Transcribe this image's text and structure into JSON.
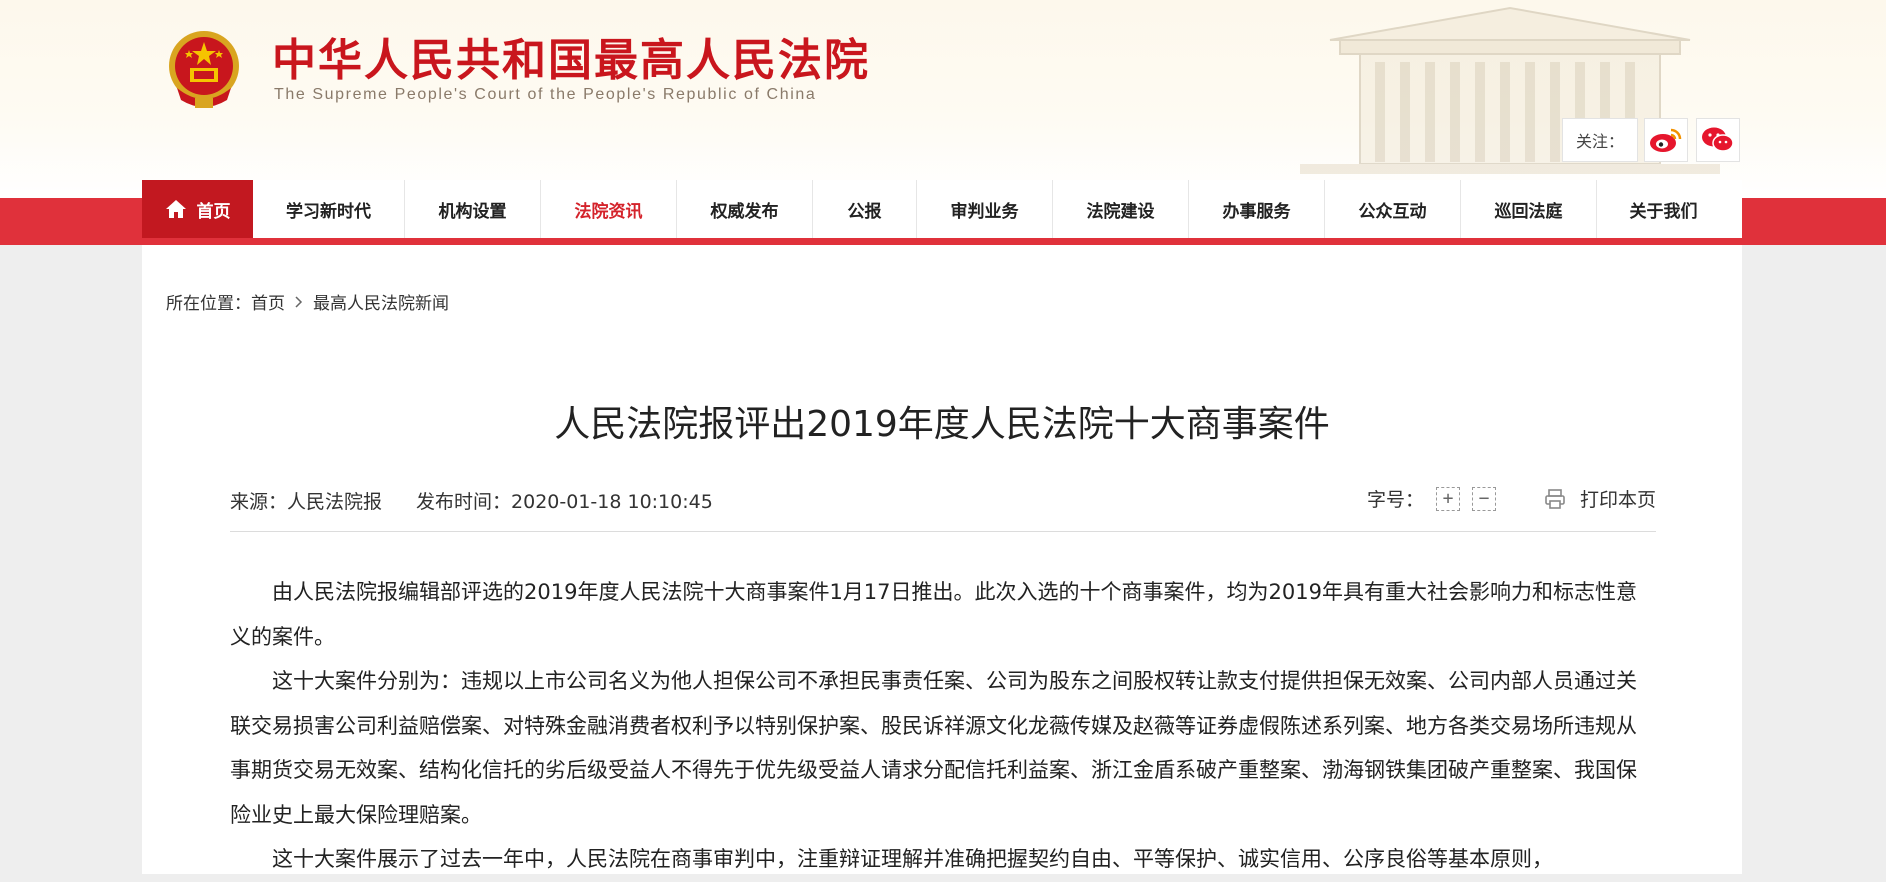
{
  "header": {
    "title": "中华人民共和国最高人民法院",
    "subtitle": "The Supreme People's Court of the People's Republic of China",
    "follow_label": "关注：",
    "social": [
      {
        "name": "weibo",
        "icon": "weibo-icon"
      },
      {
        "name": "wechat",
        "icon": "wechat-icon"
      }
    ]
  },
  "nav": {
    "items": [
      {
        "label": "首页",
        "icon": "home-icon",
        "state": "home"
      },
      {
        "label": "学习新时代"
      },
      {
        "label": "机构设置"
      },
      {
        "label": "法院资讯",
        "state": "active"
      },
      {
        "label": "权威发布"
      },
      {
        "label": "公报"
      },
      {
        "label": "审判业务"
      },
      {
        "label": "法院建设"
      },
      {
        "label": "办事服务"
      },
      {
        "label": "公众互动"
      },
      {
        "label": "巡回法庭"
      },
      {
        "label": "关于我们"
      }
    ]
  },
  "breadcrumb": {
    "label": "所在位置：",
    "items": [
      "首页",
      "最高人民法院新闻"
    ]
  },
  "article": {
    "title": "人民法院报评出2019年度人民法院十大商事案件",
    "source": "来源：人民法院报",
    "published": "发布时间：2020-01-18 10:10:45",
    "font_size_label": "字号：",
    "font_increase": "+",
    "font_decrease": "−",
    "print_label": "打印本页",
    "paragraphs": [
      "由人民法院报编辑部评选的2019年度人民法院十大商事案件1月17日推出。此次入选的十个商事案件，均为2019年具有重大社会影响力和标志性意义的案件。",
      "这十大案件分别为：违规以上市公司名义为他人担保公司不承担民事责任案、公司为股东之间股权转让款支付提供担保无效案、公司内部人员通过关联交易损害公司利益赔偿案、对特殊金融消费者权利予以特别保护案、股民诉祥源文化龙薇传媒及赵薇等证券虚假陈述系列案、地方各类交易场所违规从事期货交易无效案、结构化信托的劣后级受益人不得先于优先级受益人请求分配信托利益案、浙江金盾系破产重整案、渤海钢铁集团破产重整案、我国保险业史上最大保险理赔案。",
      "这十大案件展示了过去一年中，人民法院在商事审判中，注重辩证理解并准确把握契约自由、平等保护、诚实信用、公序良俗等基本原则，"
    ]
  },
  "colors": {
    "brand_red": "#c9161d",
    "nav_band": "#e0313b",
    "home_bg": "#c21820"
  }
}
